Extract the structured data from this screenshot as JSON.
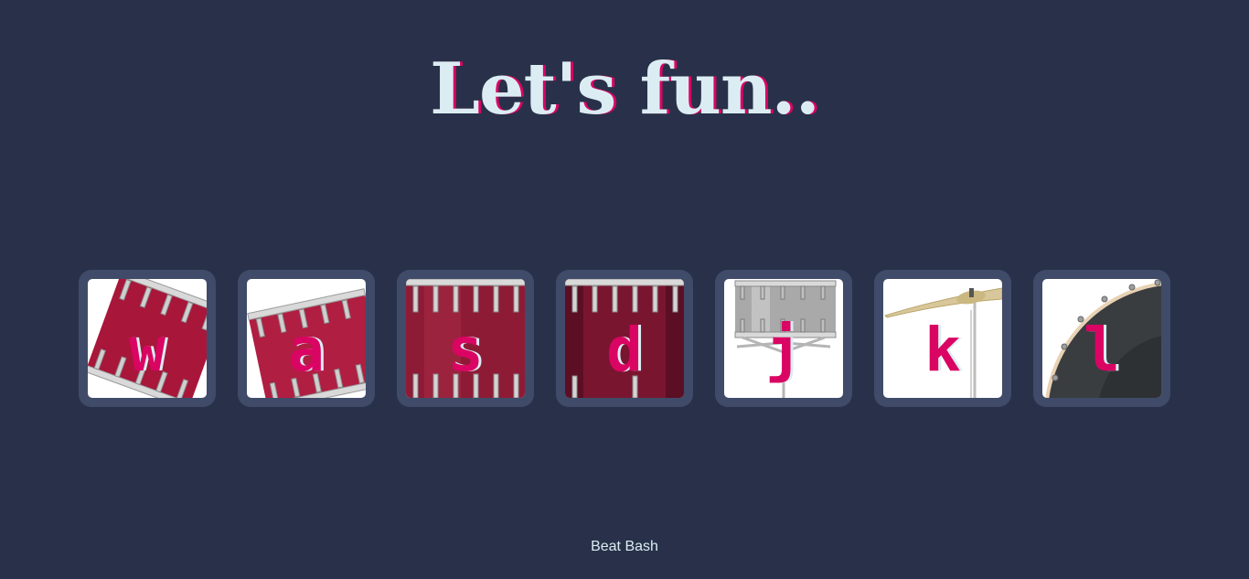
{
  "page": {
    "title": "Let's fun..",
    "footer": "Beat Bash"
  },
  "colors": {
    "background": "#283149",
    "button_frame": "#404B69",
    "key_letter": "#DA0463",
    "title_text": "#DBEDF3"
  },
  "drums": [
    {
      "key": "w",
      "instrument": "tom-1-icon"
    },
    {
      "key": "a",
      "instrument": "tom-2-icon"
    },
    {
      "key": "s",
      "instrument": "tom-3-icon"
    },
    {
      "key": "d",
      "instrument": "tom-4-icon"
    },
    {
      "key": "j",
      "instrument": "snare-icon"
    },
    {
      "key": "k",
      "instrument": "crash-cymbal-icon"
    },
    {
      "key": "l",
      "instrument": "kick-drum-icon"
    }
  ]
}
